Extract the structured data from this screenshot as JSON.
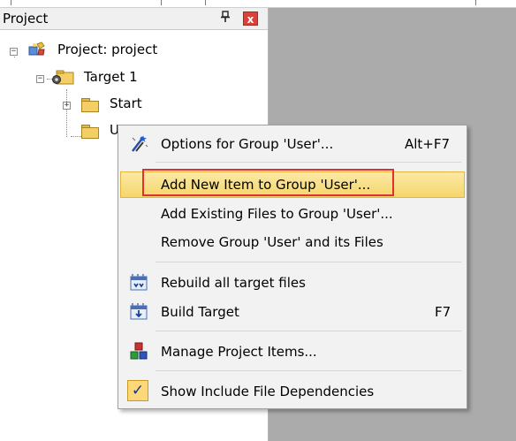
{
  "panel": {
    "title": "Project",
    "pin_glyph": "ꟸ",
    "close_glyph": "x"
  },
  "tree": {
    "root_label": "Project: project",
    "target_label": "Target 1",
    "start_label": "Start",
    "user_label": "U"
  },
  "menu": {
    "options_label": "Options for Group 'User'...",
    "options_shortcut": "Alt+F7",
    "add_new_label": "Add New  Item to Group 'User'...",
    "add_existing_label": "Add Existing Files to Group 'User'...",
    "remove_label": "Remove Group 'User' and its Files",
    "rebuild_label": "Rebuild all target files",
    "build_label": "Build Target",
    "build_shortcut": "F7",
    "manage_label": "Manage Project Items...",
    "show_deps_label": "Show Include File Dependencies",
    "check_glyph": "✓"
  },
  "icons": {
    "project": "project-icon",
    "target": "target-folder-icon",
    "folder": "folder-icon",
    "options": "options-wand-icon",
    "rebuild": "rebuild-icon",
    "build": "build-icon",
    "manage": "manage-items-icon"
  },
  "colors": {
    "highlight_top": "#fbe9a6",
    "highlight_bottom": "#f6d56a",
    "red_outline": "#e03030",
    "close_button": "#d9423a"
  }
}
